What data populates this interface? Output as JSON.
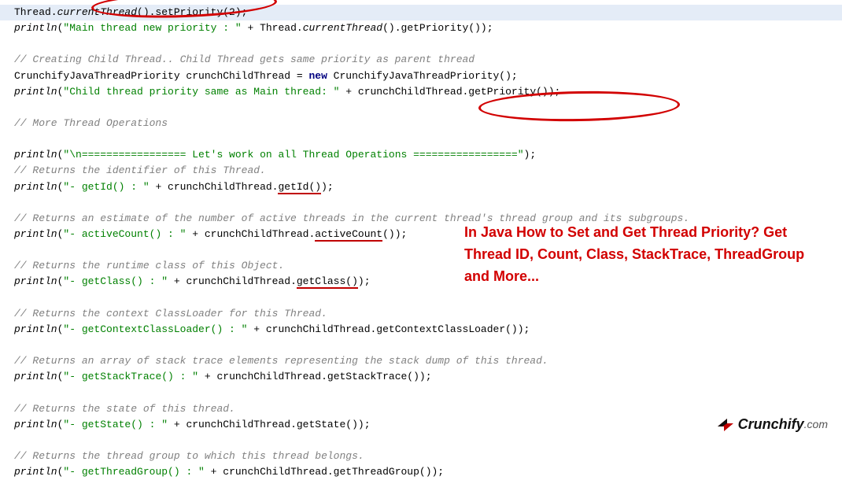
{
  "lines": {
    "l1a": "Thread.",
    "l1b": "currentThread",
    "l1c": "().setPriority(2);",
    "l2a": "println",
    "l2b": "(",
    "l2c": "\"Main thread new priority : \"",
    "l2d": " + Thread.",
    "l2e": "currentThread",
    "l2f": "().getPriority());",
    "l3": "// Creating Child Thread.. Child Thread gets same priority as parent thread",
    "l4a": "CrunchifyJavaThreadPriority crunchChildThread = ",
    "l4b": "new",
    "l4c": " CrunchifyJavaThreadPriority();",
    "l5a": "println",
    "l5b": "(",
    "l5c": "\"Child thread priority same as Main thread: \"",
    "l5d": " + crunchChildThread.getPriority());",
    "l6": "// More Thread Operations",
    "l7a": "println",
    "l7b": "(",
    "l7c": "\"\\n================= Let's work on all Thread Operations =================\"",
    "l7d": ");",
    "l8": "// Returns the identifier of this Thread.",
    "l9a": "println",
    "l9b": "(",
    "l9c": "\"- getId() : \"",
    "l9d": " + crunchChildThread.",
    "l9e": "getId()",
    "l9f": ");",
    "l10": "// Returns an estimate of the number of active threads in the current thread's thread group and its subgroups.",
    "l11a": "println",
    "l11b": "(",
    "l11c": "\"- activeCount() : \"",
    "l11d": " + crunchChildThread.",
    "l11e": "activeCount",
    "l11f": "());",
    "l12": "// Returns the runtime class of this Object.",
    "l13a": "println",
    "l13b": "(",
    "l13c": "\"- getClass() : \"",
    "l13d": " + crunchChildThread.",
    "l13e": "getClass()",
    "l13f": ");",
    "l14": "// Returns the context ClassLoader for this Thread.",
    "l15a": "println",
    "l15b": "(",
    "l15c": "\"- getContextClassLoader() : \"",
    "l15d": " + crunchChildThread.getContextClassLoader());",
    "l16": "// Returns an array of stack trace elements representing the stack dump of this thread.",
    "l17a": "println",
    "l17b": "(",
    "l17c": "\"- getStackTrace() : \"",
    "l17d": " + crunchChildThread.getStackTrace());",
    "l18": "// Returns the state of this thread.",
    "l19a": "println",
    "l19b": "(",
    "l19c": "\"- getState() : \"",
    "l19d": " + crunchChildThread.getState());",
    "l20": "// Returns the thread group to which this thread belongs.",
    "l21a": "println",
    "l21b": "(",
    "l21c": "\"- getThreadGroup() : \"",
    "l21d": " + crunchChildThread.getThreadGroup());"
  },
  "headline": "In Java How to Set and Get Thread Priority? Get Thread ID, Count, Class, StackTrace, ThreadGroup and More...",
  "logo": {
    "name": "Crunchify",
    "suffix": ".com"
  }
}
